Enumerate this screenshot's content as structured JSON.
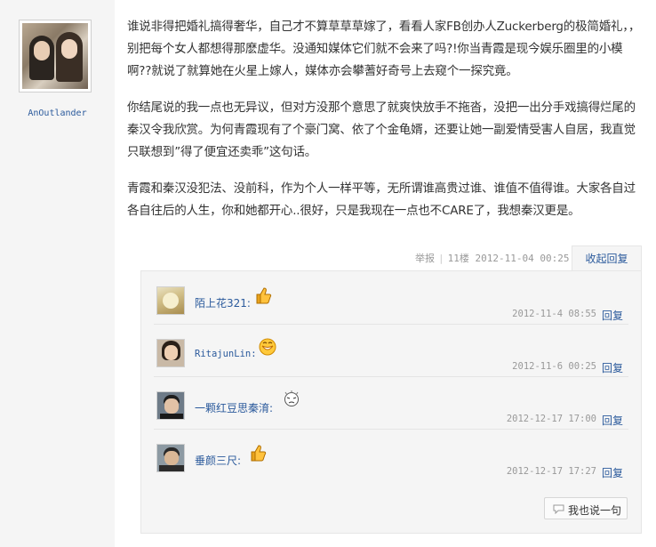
{
  "author": {
    "username": "AnOutlander"
  },
  "post": {
    "paragraphs": [
      "谁说非得把婚礼搞得奢华，自己才不算草草草嫁了，看看人家FB创办人Zuckerberg的极简婚礼，，别把每个女人都想得那麽虚华。没通知媒体它们就不会来了吗?!你当青霞是现今娱乐圈里的小模啊??就说了就算她在火星上嫁人，媒体亦会攀蓍好奇号上去窥个一探究竟。",
      "你结尾说的我一点也无异议，但对方没那个意思了就爽快放手不拖沓，没把一出分手戏搞得烂尾的秦汉令我欣赏。为何青霞现有了个豪门窝、依了个金龟婿，还要让她一副爱情受害人自居，我直觉只联想到”得了便宜还卖乖”这句话。",
      "青霞和秦汉没犯法、没前科，作为个人一样平等，无所谓谁高贵过谁、谁值不值得谁。大家各自过各自往后的人生，你和她都开心..很好，只是我现在一点也不CARE了，我想秦汉更是。"
    ]
  },
  "meta": {
    "report_label": "举报",
    "floor_label": "11楼",
    "timestamp": "2012-11-04 00:25",
    "collapse_label": "收起回复"
  },
  "replies": [
    {
      "username": "陌上花321",
      "emoji": "thumbs-up-icon",
      "date": "2012-11-4 08:55",
      "reply_label": "回复"
    },
    {
      "username": "RitajunLin",
      "emoji": "smiley-icon",
      "date": "2012-11-6 00:25",
      "reply_label": "回复"
    },
    {
      "username": "一颗红豆思秦淯",
      "emoji": "crying-face-icon",
      "date": "2012-12-17 17:00",
      "reply_label": "回复"
    },
    {
      "username": "垂颜三尺",
      "emoji": "thumbs-up-icon",
      "date": "2012-12-17 17:27",
      "reply_label": "回复"
    }
  ],
  "say_button": {
    "label": "我也说一句"
  },
  "colors": {
    "link": "#2b5a9c",
    "text": "#333333",
    "muted": "#999999",
    "panel": "#f5f5f5"
  }
}
